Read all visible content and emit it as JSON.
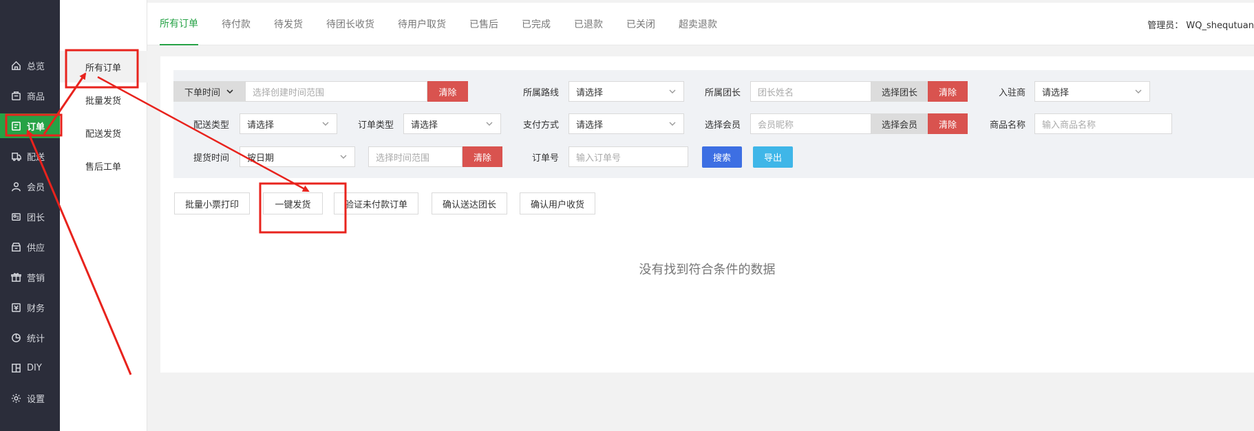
{
  "nav": {
    "items": [
      {
        "label": "总览",
        "icon": "home-icon"
      },
      {
        "label": "商品",
        "icon": "goods-icon"
      },
      {
        "label": "订单",
        "icon": "order-icon"
      },
      {
        "label": "配送",
        "icon": "delivery-icon"
      },
      {
        "label": "会员",
        "icon": "member-icon"
      },
      {
        "label": "团长",
        "icon": "leader-icon"
      },
      {
        "label": "供应",
        "icon": "supply-icon"
      },
      {
        "label": "营销",
        "icon": "gift-icon"
      },
      {
        "label": "财务",
        "icon": "finance-icon"
      },
      {
        "label": "统计",
        "icon": "pie-chart-icon"
      },
      {
        "label": "DIY",
        "icon": "layout-icon"
      },
      {
        "label": "设置",
        "icon": "gear-icon"
      }
    ]
  },
  "submenu": {
    "items": [
      "所有订单",
      "批量发货",
      "配送发货",
      "售后工单"
    ]
  },
  "tabs": [
    "所有订单",
    "待付款",
    "待发货",
    "待团长收货",
    "待用户取货",
    "已售后",
    "已完成",
    "已退款",
    "已关闭",
    "超卖退款"
  ],
  "header": {
    "admin": "管理员： WQ_shequtuan"
  },
  "filters": {
    "order_time": "下单时间",
    "time_placeholder": "选择创建时间范围",
    "clear": "清除",
    "route_label": "所属路线",
    "select_placeholder": "请选择",
    "leader_label": "所属团长",
    "leader_placeholder": "团长姓名",
    "choose_leader": "选择团长",
    "merchant_label": "入驻商",
    "delivery_type_label": "配送类型",
    "order_type_label": "订单类型",
    "pay_method_label": "支付方式",
    "member_label": "选择会员",
    "member_placeholder": "会员昵称",
    "choose_member": "选择会员",
    "product_label": "商品名称",
    "product_placeholder": "输入商品名称",
    "pickup_label": "提货时间",
    "pickup_value": "按日期",
    "pickup_range_placeholder": "选择时间范围",
    "order_no_label": "订单号",
    "order_no_placeholder": "输入订单号",
    "search": "搜索",
    "export": "导出"
  },
  "actions": [
    "批量小票打印",
    "一键发货",
    "验证未付款订单",
    "确认送达团长",
    "确认用户收货"
  ],
  "empty_text": "没有找到符合条件的数据",
  "colors": {
    "accent": "#26a246",
    "danger": "#d9534f",
    "primary": "#3d6fe3",
    "info": "#3fb6e8",
    "annotation": "#e8231d"
  }
}
